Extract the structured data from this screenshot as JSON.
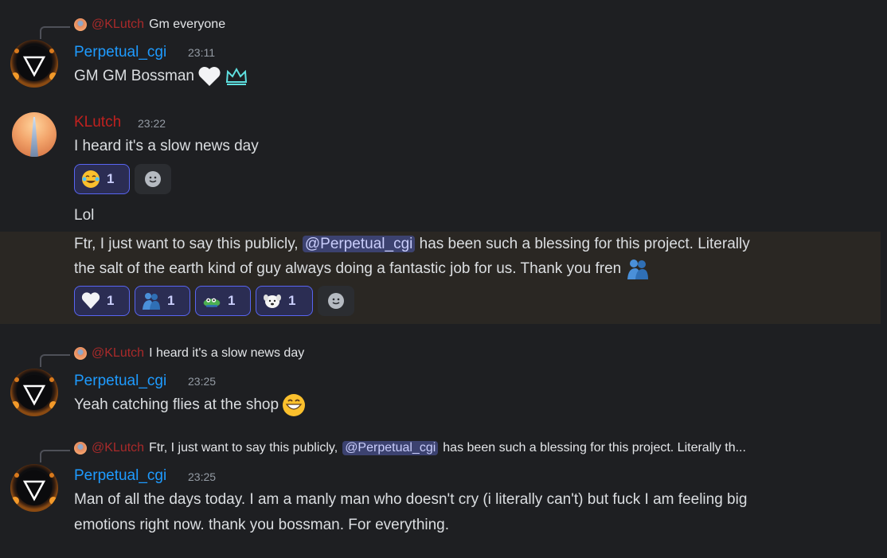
{
  "colors": {
    "background": "#1e1f22",
    "perpetual": "#1e9bff",
    "klutch": "#c0211f",
    "mention_bg": "#3c4270",
    "reaction_border": "#5865f2"
  },
  "messages": [
    {
      "reply_to": {
        "author": "@KLutch",
        "text": "Gm everyone"
      },
      "author": "Perpetual_cgi",
      "time": "23:11",
      "text": "GM GM Bossman",
      "emojis": [
        "white-heart-icon",
        "crown-icon"
      ]
    },
    {
      "author": "KLutch",
      "time": "23:22",
      "text": "I heard it's a slow news day",
      "reactions": [
        {
          "emoji": "joy-icon",
          "count": "1"
        }
      ],
      "followups": [
        {
          "text": "Lol"
        },
        {
          "text_before": "Ftr, I just want to say this publicly,",
          "mention": "@Perpetual_cgi",
          "text_after_line1": "has been such a blessing for this project. Literally",
          "text_line2": "the salt of the earth kind of guy always doing a fantastic job for us. Thank you fren",
          "reactions": [
            {
              "emoji": "white-heart-icon",
              "count": "1"
            },
            {
              "emoji": "people-hugging-icon",
              "count": "1"
            },
            {
              "emoji": "pepe-icon",
              "count": "1"
            },
            {
              "emoji": "dog-icon",
              "count": "1"
            }
          ]
        }
      ]
    },
    {
      "reply_to": {
        "author": "@KLutch",
        "text": "I heard it's a slow news day"
      },
      "author": "Perpetual_cgi",
      "time": "23:25",
      "text": "Yeah catching flies at the shop"
    },
    {
      "reply_to": {
        "author": "@KLutch",
        "text_before": "Ftr, I just want to say this publicly,",
        "mention": "@Perpetual_cgi",
        "text_after": "has been such a blessing for this project. Literally th..."
      },
      "author": "Perpetual_cgi",
      "time": "23:25",
      "line1": "Man of all the days today. I am a manly man who doesn't cry (i literally can't) but fuck I am feeling big",
      "line2": "emotions right now. thank you bossman. For everything."
    }
  ]
}
